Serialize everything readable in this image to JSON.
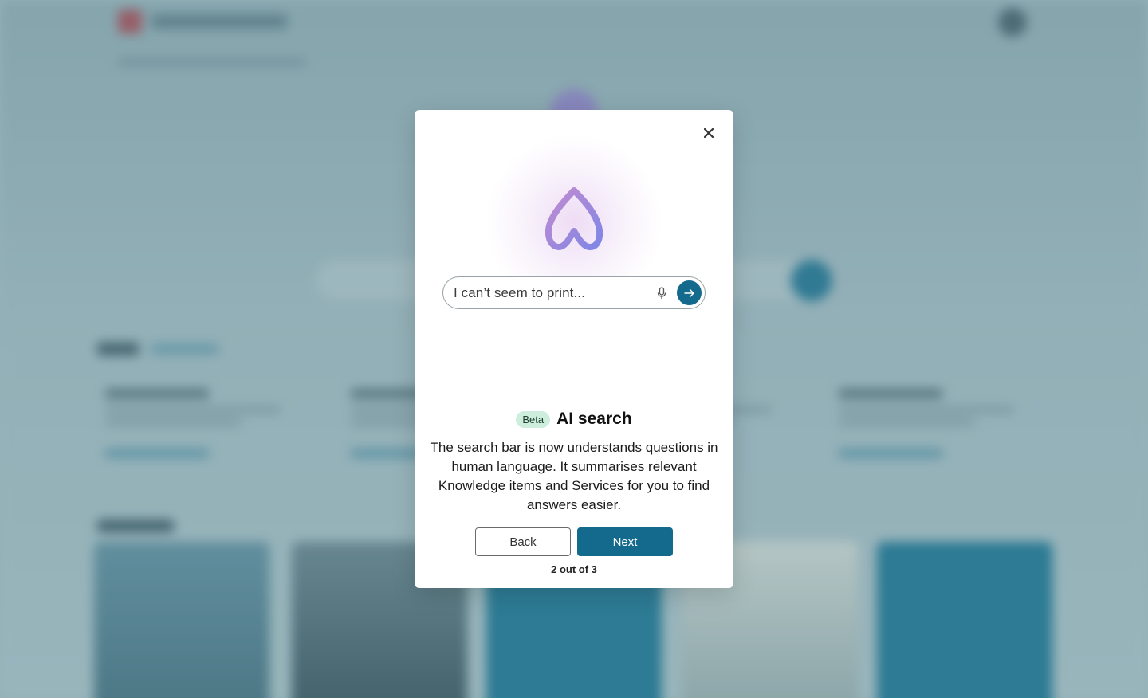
{
  "modal": {
    "close_label": "✕",
    "demo_search": {
      "text": "I can’t seem to print..."
    },
    "badge": "Beta",
    "title": "AI search",
    "description": "The search bar is now understands questions in human language. It summarises relevant Knowledge items and Services for you to find answers easier.",
    "back_label": "Back",
    "next_label": "Next",
    "step_text": "2 out of 3"
  },
  "colors": {
    "accent": "#136a8d",
    "badge_bg": "#cdeedd",
    "logo_gradient_start": "#c38bd0",
    "logo_gradient_end": "#7f86e6"
  },
  "icons": {
    "close": "close-icon",
    "logo": "ai-flame-icon",
    "mic": "microphone-icon",
    "submit": "arrow-right-icon"
  }
}
